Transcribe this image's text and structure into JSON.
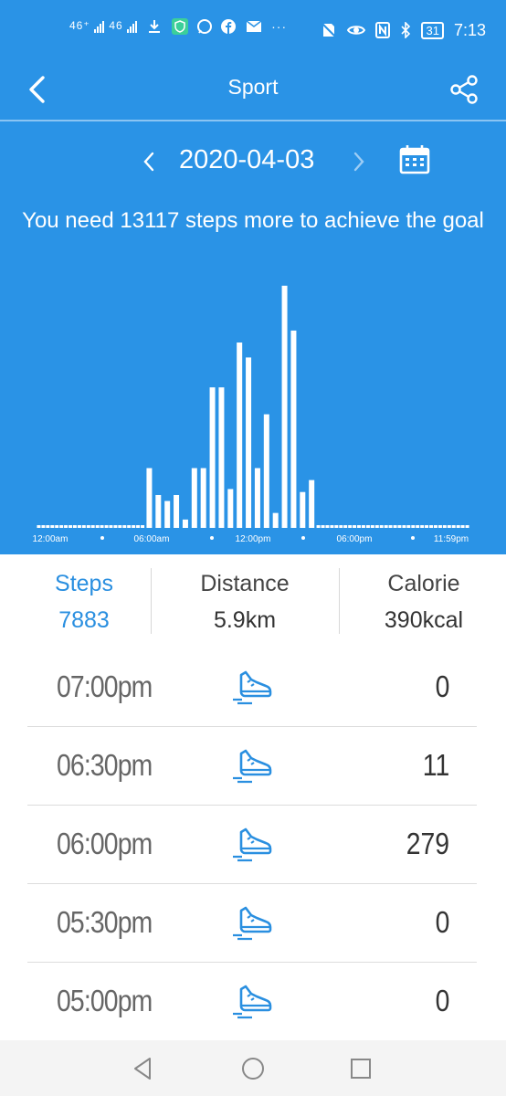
{
  "status_bar": {
    "network_left": "46⁺",
    "network_right": "46",
    "time": "7:13",
    "battery": "31"
  },
  "app_bar": {
    "title": "Sport",
    "back_icon": "chevron-left-icon",
    "share_icon": "share-icon"
  },
  "date_nav": {
    "date": "2020-04-03",
    "prev_icon": "chevron-left-icon",
    "next_icon": "chevron-right-icon",
    "calendar_icon": "calendar-icon"
  },
  "goal_message": "You need 13117 steps more to achieve the goal",
  "chart_data": {
    "type": "bar",
    "x_tick_labels": [
      "12:00am",
      "06:00am",
      "12:00pm",
      "06:00pm",
      "11:59pm"
    ],
    "categories": [
      "00:00",
      "00:30",
      "01:00",
      "01:30",
      "02:00",
      "02:30",
      "03:00",
      "03:30",
      "04:00",
      "04:30",
      "05:00",
      "05:30",
      "06:00",
      "06:30",
      "07:00",
      "07:30",
      "08:00",
      "08:30",
      "09:00",
      "09:30",
      "10:00",
      "10:30",
      "11:00",
      "11:30",
      "12:00",
      "12:30",
      "13:00",
      "13:30",
      "14:00",
      "14:30",
      "15:00",
      "15:30",
      "16:00",
      "16:30",
      "17:00",
      "17:30",
      "18:00",
      "18:30",
      "19:00",
      "19:30",
      "20:00",
      "20:30",
      "21:00",
      "21:30",
      "22:00",
      "22:30",
      "23:00",
      "23:30"
    ],
    "values": [
      0,
      0,
      0,
      0,
      0,
      0,
      0,
      0,
      0,
      0,
      0,
      0,
      100,
      55,
      45,
      55,
      14,
      100,
      100,
      235,
      235,
      65,
      310,
      285,
      100,
      190,
      25,
      405,
      330,
      60,
      80,
      0,
      0,
      0,
      0,
      0,
      0,
      0,
      0,
      0,
      0,
      0,
      0,
      0,
      0,
      0,
      0,
      0
    ],
    "ylim": [
      0,
      420
    ],
    "grid": false,
    "bar_color": "#ffffff"
  },
  "stats": {
    "steps": {
      "label": "Steps",
      "value": "7883"
    },
    "distance": {
      "label": "Distance",
      "value": "5.9km"
    },
    "calorie": {
      "label": "Calorie",
      "value": "390kcal"
    }
  },
  "entries": [
    {
      "time": "07:00pm",
      "count": "0"
    },
    {
      "time": "06:30pm",
      "count": "11"
    },
    {
      "time": "06:00pm",
      "count": "279"
    },
    {
      "time": "05:30pm",
      "count": "0"
    },
    {
      "time": "05:00pm",
      "count": "0"
    }
  ],
  "colors": {
    "primary": "#2a93e6",
    "active_text": "#2a8fe0"
  }
}
